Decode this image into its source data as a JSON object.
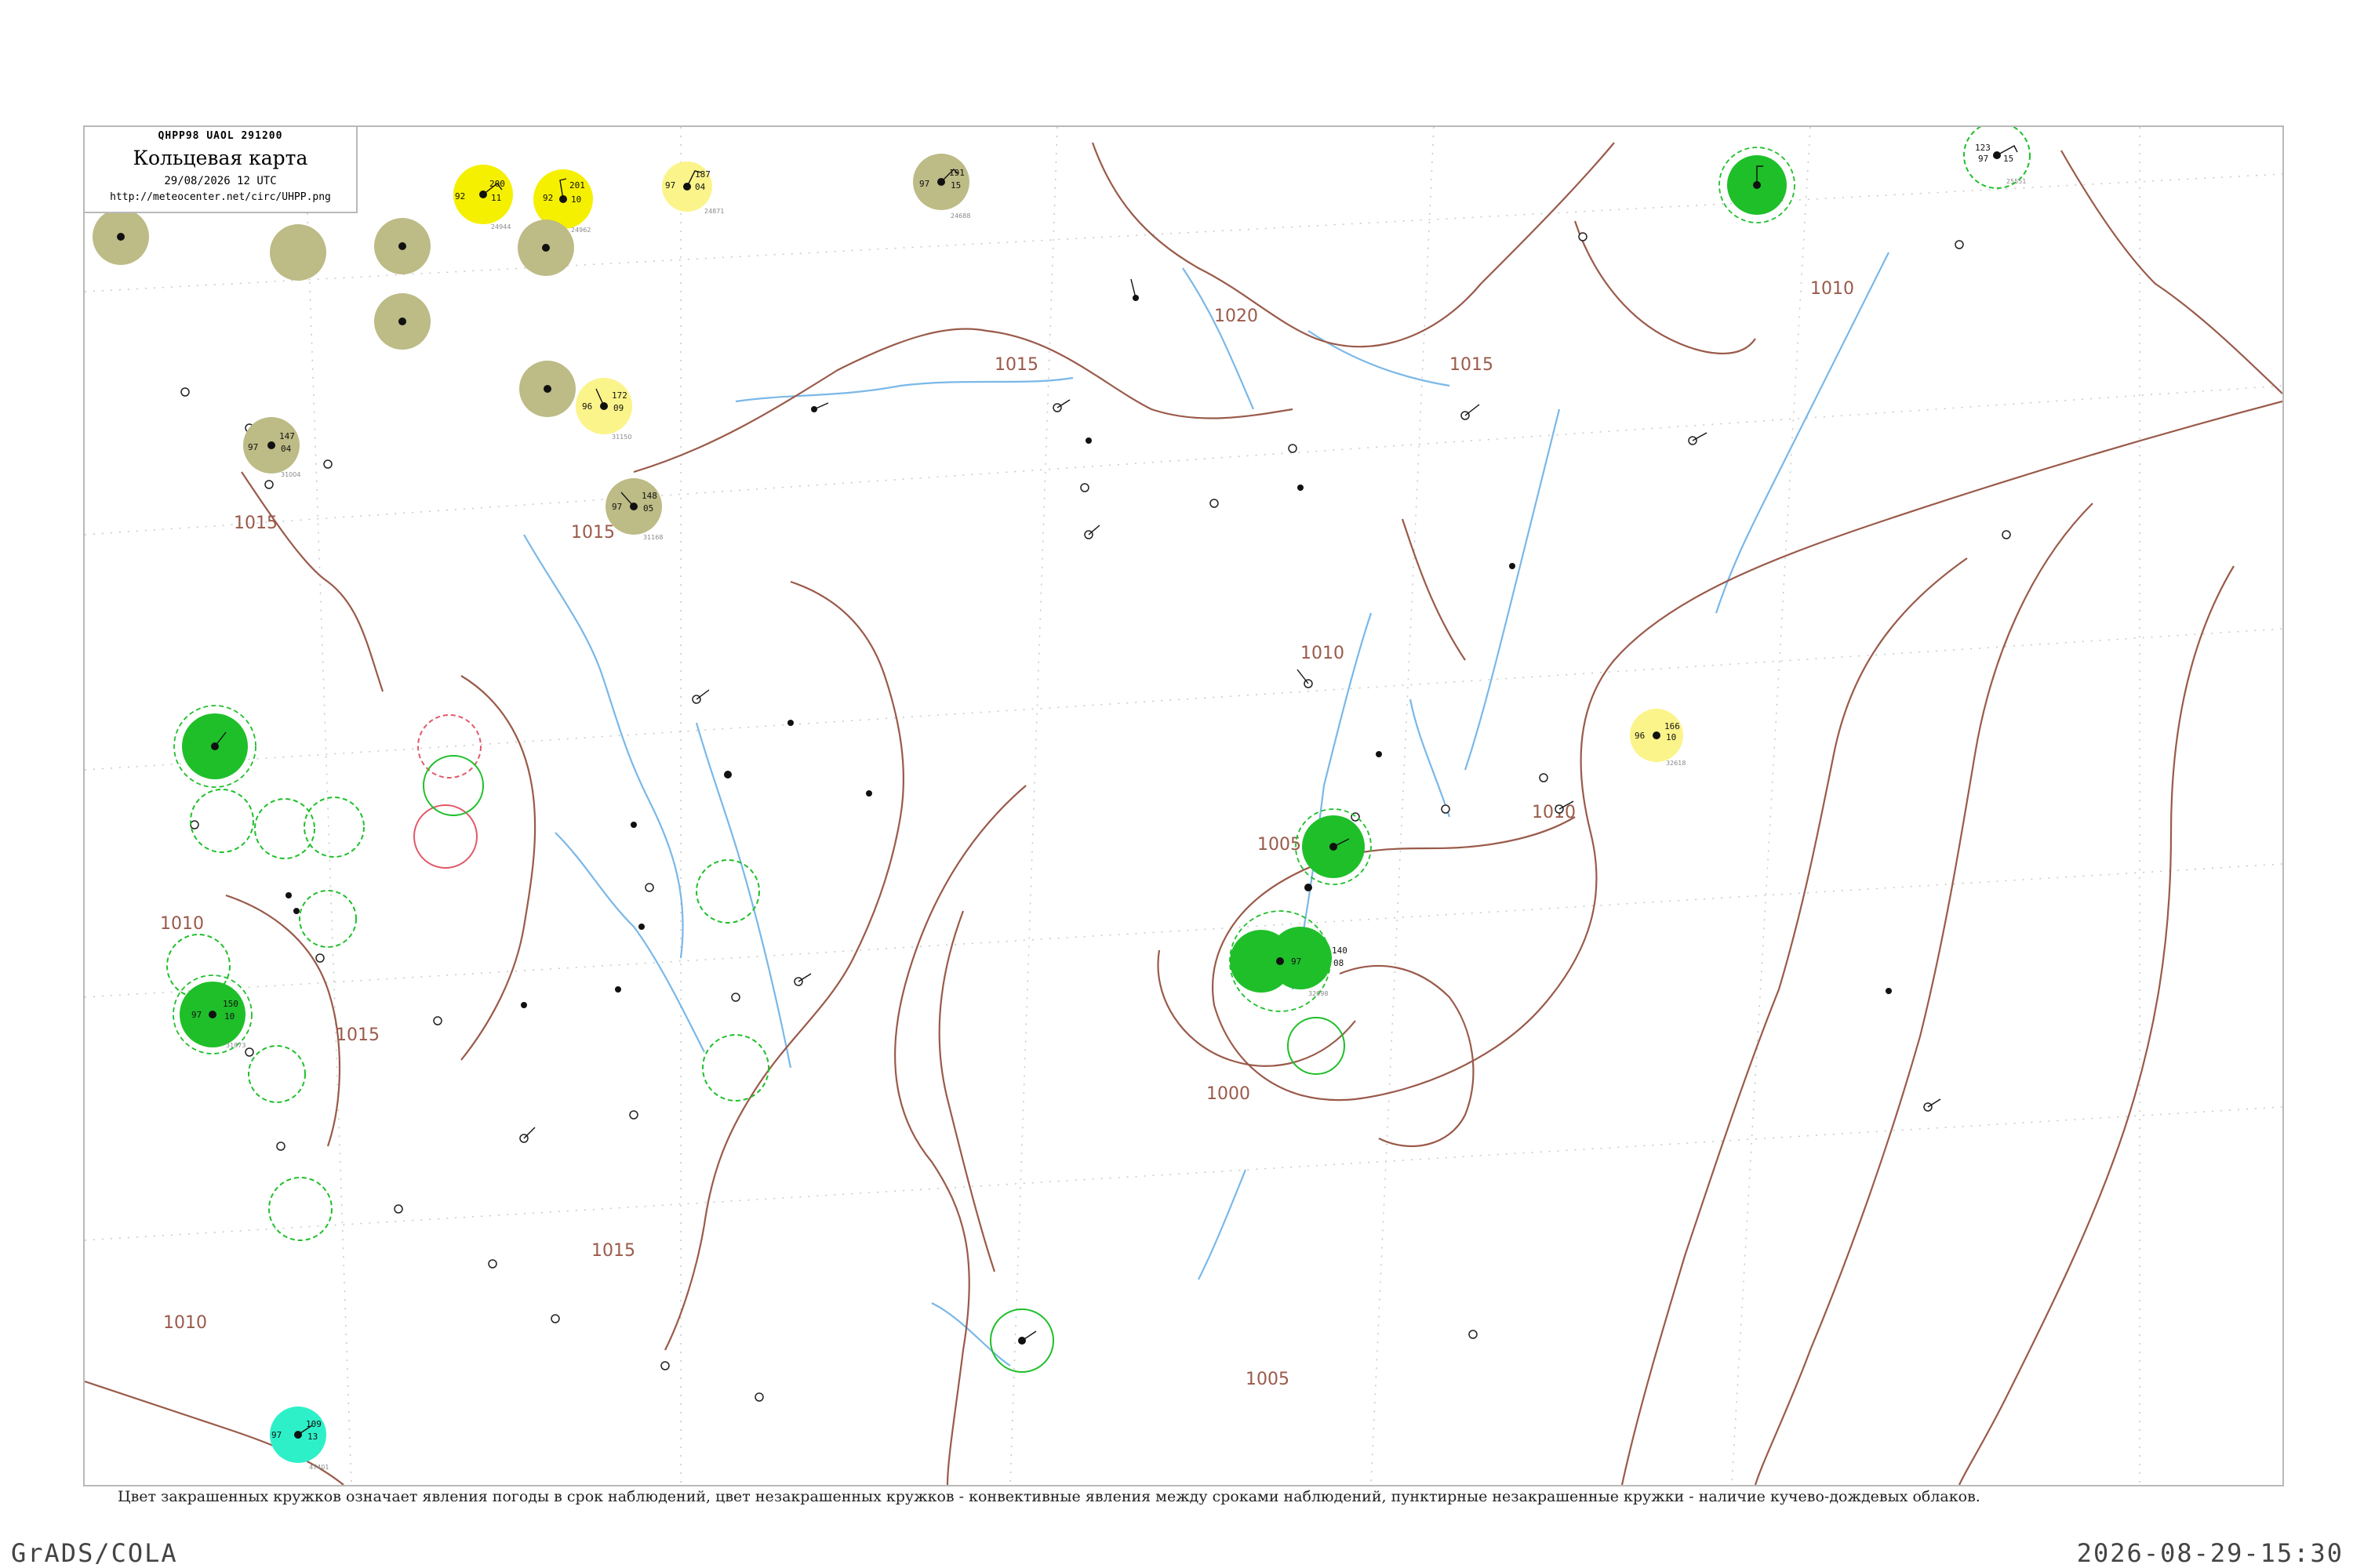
{
  "header": {
    "code": "QHPP98  UAOL  291200",
    "title": "Кольцевая карта",
    "date": "29/08/2026 12 UTC",
    "url": "http://meteocenter.net/circ/UHPP.png"
  },
  "caption": "Цвет закрашенных кружков означает явления погоды в срок наблюдений, цвет незакрашенных кружков - конвективные явления между сроками наблюдений, пунктирные незакрашенные кружки - наличие кучево-дождевых облаков.",
  "footer": {
    "left": "GrADS/COLA",
    "right": "2026-08-29-15:30"
  },
  "colors": {
    "isobar": "#9a5a4a",
    "river": "#7ab8e8",
    "grid": "#c8c8c8",
    "olive": "#bdbb86",
    "yellow": "#f5f000",
    "light_yellow": "#fbf48a",
    "green": "#1fbf2a",
    "cyan": "#2ef0c8",
    "frame": "#b9b9b9"
  },
  "isobar_labels": [
    "1015",
    "1015",
    "1015",
    "1015",
    "1010",
    "1010",
    "1010",
    "1020",
    "1015",
    "1010",
    "1005",
    "1000",
    "1005",
    "1010",
    "1015"
  ],
  "stations": [
    {
      "id": "24944",
      "temp": "200",
      "dew": "92",
      "press": "11",
      "color": "yellow"
    },
    {
      "id": "24962",
      "temp": "201",
      "dew": "92",
      "press": "10",
      "color": "yellow"
    },
    {
      "id": "24871",
      "temp": "187",
      "dew": "97",
      "press": "04",
      "color": "light_yellow"
    },
    {
      "id": "24688",
      "temp": "191",
      "dew": "97",
      "press": "15",
      "color": "olive"
    },
    {
      "id": "31150",
      "temp": "172",
      "dew": "96",
      "press": "09",
      "color": "light_yellow"
    },
    {
      "id": "31168",
      "temp": "148",
      "dew": "97",
      "press": "05",
      "color": "olive"
    },
    {
      "id": "31004",
      "temp": "147",
      "dew": "97",
      "press": "04",
      "color": "olive"
    },
    {
      "id": "32618",
      "temp": "166",
      "dew": "96",
      "press": "10",
      "color": "light_yellow"
    },
    {
      "id": "25551",
      "temp": "123",
      "dew": "97",
      "press": "15",
      "color": "green"
    },
    {
      "id": "32098",
      "temp": "140",
      "dew": "97",
      "press": "08",
      "color": "green"
    },
    {
      "id": "31873",
      "temp": "150",
      "dew": "97",
      "press": "10",
      "color": "green"
    },
    {
      "id": "47401",
      "temp": "109",
      "dew": "97",
      "press": "13",
      "color": "cyan"
    }
  ]
}
